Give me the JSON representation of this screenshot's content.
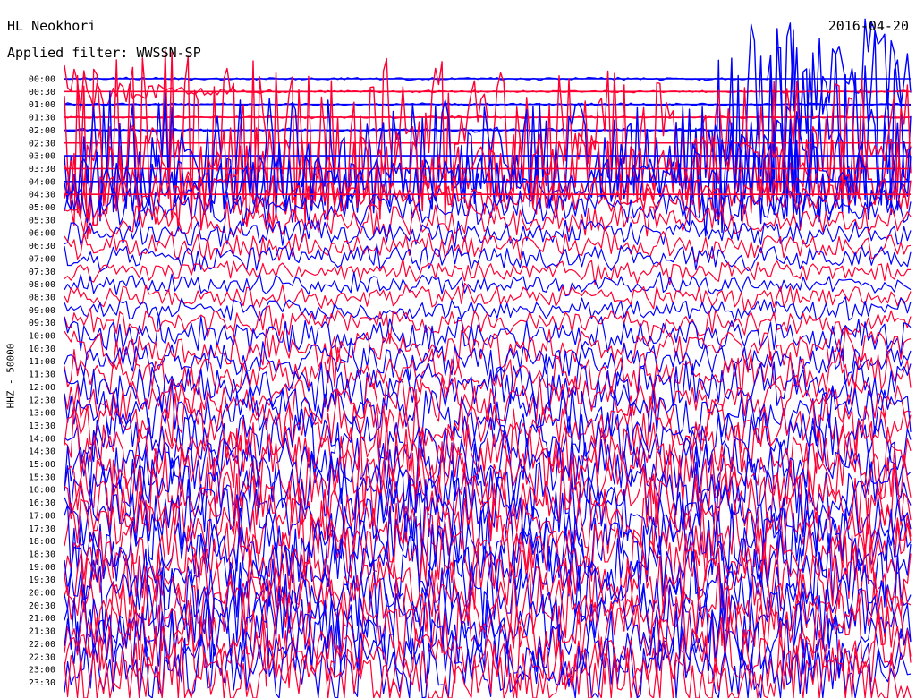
{
  "header": {
    "station": "HL Neokhori",
    "date": "2016-04-20",
    "filter": "Applied filter: WWSSN-SP"
  },
  "channel_label": "HHZ - 50000",
  "colors": {
    "trace_a": "#0000ff",
    "trace_b": "#ff0033",
    "background": "#ffffff"
  },
  "chart_data": {
    "type": "line",
    "title": "HL Neokhori",
    "subtitle": "Applied filter: WWSSN-SP",
    "ylabel": "HHZ - 50000",
    "xlabel": "",
    "y_axis_order": "top-to-bottom",
    "categories": [
      "00:00",
      "00:30",
      "01:00",
      "01:30",
      "02:00",
      "02:30",
      "03:00",
      "03:30",
      "04:00",
      "04:30",
      "05:00",
      "05:30",
      "06:00",
      "06:30",
      "07:00",
      "07:30",
      "08:00",
      "08:30",
      "09:00",
      "09:30",
      "10:00",
      "10:30",
      "11:00",
      "11:30",
      "12:00",
      "12:30",
      "13:00",
      "13:30",
      "14:00",
      "14:30",
      "15:00",
      "15:30",
      "16:00",
      "16:30",
      "17:00",
      "17:30",
      "18:00",
      "18:30",
      "19:00",
      "19:30",
      "20:00",
      "20:30",
      "21:00",
      "21:30",
      "22:00",
      "22:30",
      "23:00",
      "23:30"
    ],
    "series": [
      {
        "color": "#0000ff",
        "rows": "even (00:00, 01:00, ...)"
      },
      {
        "color": "#ff0033",
        "rows": "odd (00:30, 01:30, ...)"
      }
    ],
    "relative_amplitude": [
      0.15,
      0.12,
      0.15,
      0.12,
      0.2,
      0.25,
      0.35,
      0.3,
      0.35,
      0.4,
      0.8,
      1.0,
      1.0,
      1.2,
      1.2,
      1.0,
      1.0,
      1.2,
      1.2,
      1.5,
      1.8,
      2.0,
      2.0,
      2.2,
      2.5,
      2.5,
      3.0,
      3.0,
      3.0,
      3.5,
      3.5,
      4.0,
      4.0,
      4.0,
      4.0,
      4.0,
      4.0,
      4.0,
      4.0,
      4.0,
      4.0,
      4.0,
      4.0,
      4.0,
      4.0,
      4.0,
      4.0,
      4.0
    ],
    "events": [
      {
        "time_row": "02:00",
        "minute": 23,
        "peak": 14,
        "decay": 12,
        "label": ""
      },
      {
        "time_row": "04:00",
        "minute": 22,
        "peak": 8,
        "decay": 2,
        "label": ""
      },
      {
        "time_row": "03:00",
        "minute": 2,
        "peak": 2,
        "decay": 6,
        "label": ""
      },
      {
        "time_row": "03:30",
        "minute": 13,
        "peak": 2,
        "decay": 4,
        "label": ""
      },
      {
        "time_row": "00:00",
        "minute": 28,
        "peak": 10,
        "decay": 0.3,
        "label": ""
      },
      {
        "time_row": "00:00",
        "minute": 25,
        "peak": 14,
        "decay": 0.3,
        "label": ""
      },
      {
        "time_row": "03:00",
        "minute": 20,
        "peak": 2.5,
        "decay": 3,
        "label": ""
      }
    ],
    "grid": false,
    "legend": "none"
  }
}
